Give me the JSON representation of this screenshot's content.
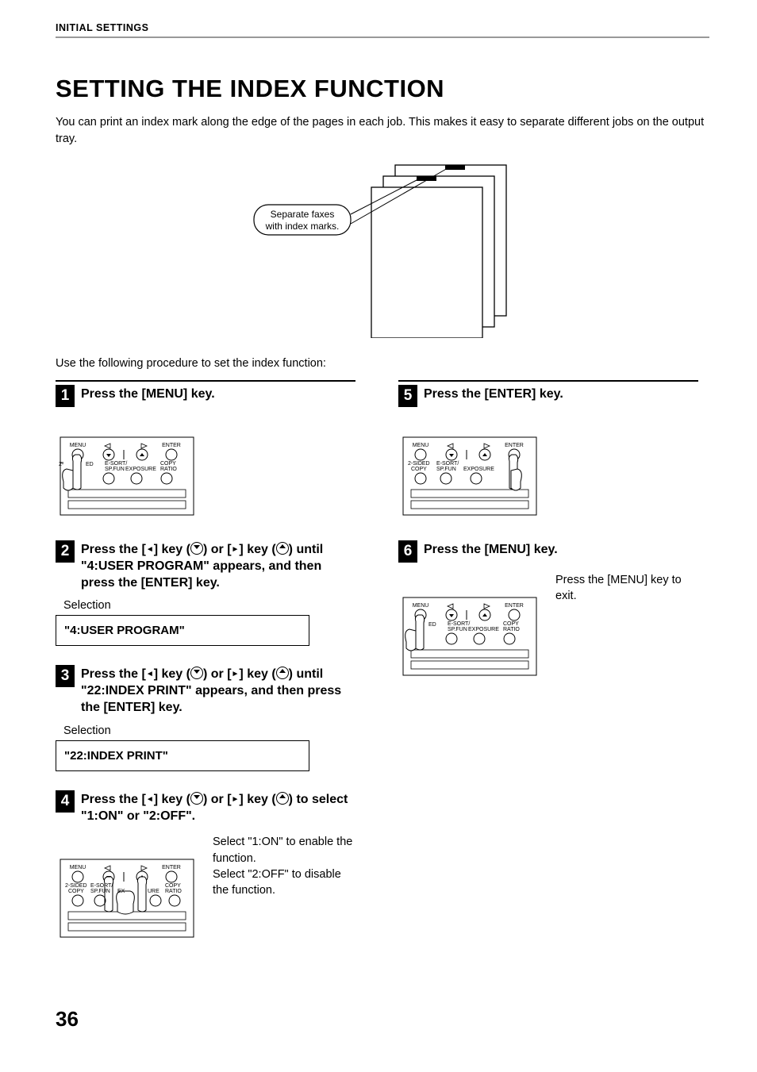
{
  "header": {
    "running_head": "INITIAL SETTINGS"
  },
  "title": "SETTING THE INDEX FUNCTION",
  "intro1": "You can print an index mark along the edge of the pages in each job. This makes it easy to separate different jobs on the output tray.",
  "callout": {
    "line1": "Separate faxes",
    "line2": "with index marks."
  },
  "intro2": "Use the following procedure to set the index function:",
  "steps": {
    "s1": {
      "num": "1",
      "title": "Press the [MENU] key."
    },
    "s2": {
      "num": "2",
      "title_a": "Press the [",
      "title_b": "] key (",
      "title_c": ") or [",
      "title_d": "] key (",
      "title_e": ") until \"4:USER PROGRAM\" appears, and then press the [ENTER] key.",
      "selection_label": "Selection",
      "display": "\"4:USER PROGRAM\""
    },
    "s3": {
      "num": "3",
      "title_a": "Press the [",
      "title_b": "] key (",
      "title_c": ") or [",
      "title_d": "] key (",
      "title_e": ") until \"22:INDEX PRINT\" appears, and then press the [ENTER] key.",
      "selection_label": "Selection",
      "display": "\"22:INDEX PRINT\""
    },
    "s4": {
      "num": "4",
      "title_a": "Press the [",
      "title_b": "] key (",
      "title_c": ") or [",
      "title_d": "] key (",
      "title_e": ") to select \"1:ON\" or \"2:OFF\".",
      "note1": "Select \"1:ON\" to enable the function.",
      "note2": "Select \"2:OFF\" to disable the function."
    },
    "s5": {
      "num": "5",
      "title": "Press the [ENTER] key."
    },
    "s6": {
      "num": "6",
      "title": "Press the [MENU] key.",
      "note": "Press the [MENU] key to exit."
    }
  },
  "panel": {
    "menu": "MENU",
    "enter": "ENTER",
    "twosided": "2-SIDED",
    "copy_l": "COPY",
    "esort": "E-SORT/",
    "spfun": "SP.FUN",
    "exposure": "EXPOSURE",
    "copy": "COPY",
    "ratio": "RATIO"
  },
  "page_number": "36"
}
